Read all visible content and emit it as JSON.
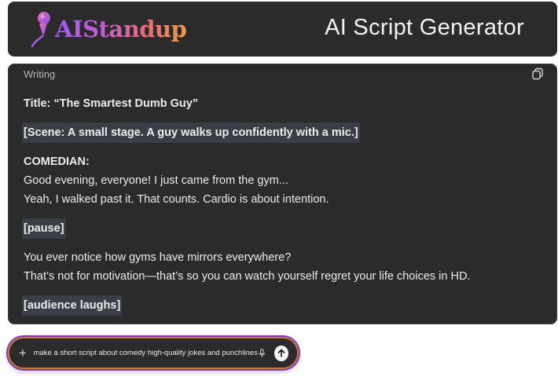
{
  "header": {
    "logo_text": "AIStandup",
    "title": "AI Script Generator"
  },
  "panel": {
    "label": "Writing",
    "icon": "copy-icon",
    "script": {
      "title_line": "Title: “The Smartest Dumb Guy”",
      "scene": "[Scene: A small stage. A guy walks up confidently with a mic.]",
      "speaker": "COMEDIAN:",
      "line1": "Good evening, everyone! I just came from the gym...",
      "line2": "Yeah, I walked past it. That counts. Cardio is about intention.",
      "pause": "[pause]",
      "line3": "You ever notice how gyms have mirrors everywhere?",
      "line4": "That’s not for motivation—that’s so you can watch yourself regret your life choices in HD.",
      "laughs": "[audience laughs]"
    }
  },
  "chat": {
    "plus_icon": "+",
    "prompt": "make a short script about comedy high-quality jokes and punchlines",
    "mic_icon": "microphone-icon",
    "send_icon": "arrow-up-icon"
  },
  "colors": {
    "background": "#ffffff",
    "card": "#2b2b2b",
    "highlight": "#3a3f47",
    "accent_purple": "#7d3fc2",
    "accent_orange": "#c8782f"
  }
}
